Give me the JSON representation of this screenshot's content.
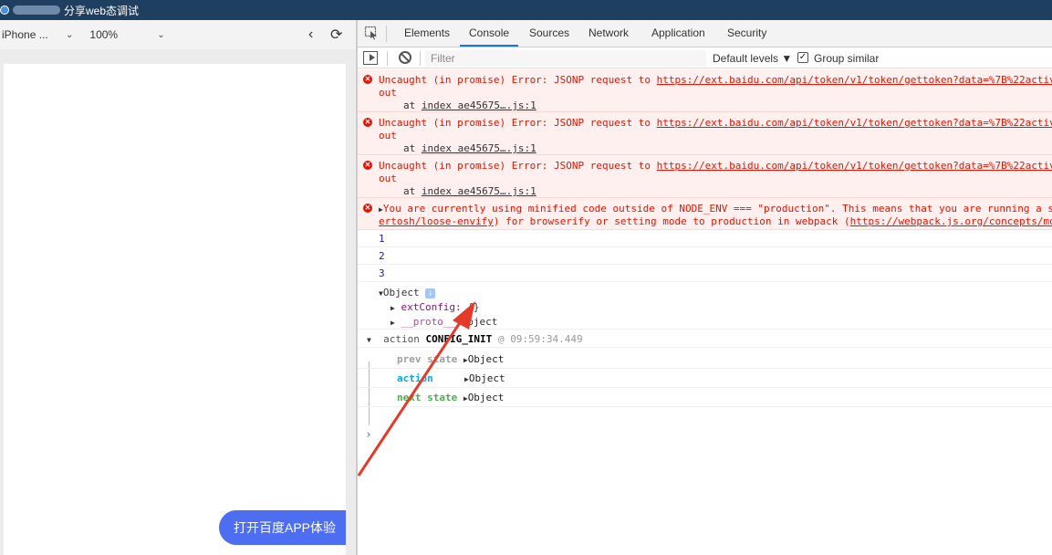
{
  "window": {
    "title": "分享web态调试"
  },
  "device_toolbar": {
    "device": "iPhone ...",
    "zoom": "100%"
  },
  "page": {
    "open_app_button": "打开百度APP体验"
  },
  "devtools": {
    "tabs": [
      "Elements",
      "Console",
      "Sources",
      "Network",
      "Application",
      "Security"
    ],
    "active_tab": "Console",
    "filter_placeholder": "Filter",
    "levels": "Default levels ▼",
    "group_similar": "Group similar",
    "group_similar_checked": true
  },
  "console": {
    "errors": [
      {
        "text": "Uncaught (in promise) Error: JSONP request to ",
        "url": "https://ext.baidu.com/api/token/v1/token/gettoken?data=%7B%22activ",
        "wrap": "out",
        "at": "at ",
        "source": "index ae45675….js:1"
      },
      {
        "text": "Uncaught (in promise) Error: JSONP request to ",
        "url": "https://ext.baidu.com/api/token/v1/token/gettoken?data=%7B%22activ",
        "wrap": "out",
        "at": "at ",
        "source": "index ae45675….js:1"
      },
      {
        "text": "Uncaught (in promise) Error: JSONP request to ",
        "url": "https://ext.baidu.com/api/token/v1/token/gettoken?data=%7B%22activ",
        "wrap": "out",
        "at": "at ",
        "source": "index ae45675….js:1"
      }
    ],
    "warning_line1": "You are currently using minified code outside of NODE_ENV === \"production\". This means that you are running a s",
    "warning_line2_link": "ertosh/loose-envify",
    "warning_line2_mid": ") for browserify or setting mode to production in webpack (",
    "warning_line2_link2": "https://webpack.js.org/concepts/mo",
    "logs": [
      "1",
      "2",
      "3"
    ],
    "object": {
      "label": "Object",
      "badge": "i",
      "prop1_key": "extConfig:",
      "prop1_val": "{}",
      "prop2_key": "__proto__:",
      "prop2_val": "Object"
    },
    "action_group": {
      "label": "action",
      "name": "CONFIG_INIT",
      "at": "@",
      "time": "09:59:34.449",
      "prev_state": "prev state",
      "action": "action",
      "next_state": "next state",
      "value": "Object"
    },
    "prompt": "›"
  },
  "colors": {
    "titlebar": "#1e3f5f",
    "error": "#e51400",
    "open_app_button": "#4e6ef2",
    "arrow": "#e53a2a"
  }
}
